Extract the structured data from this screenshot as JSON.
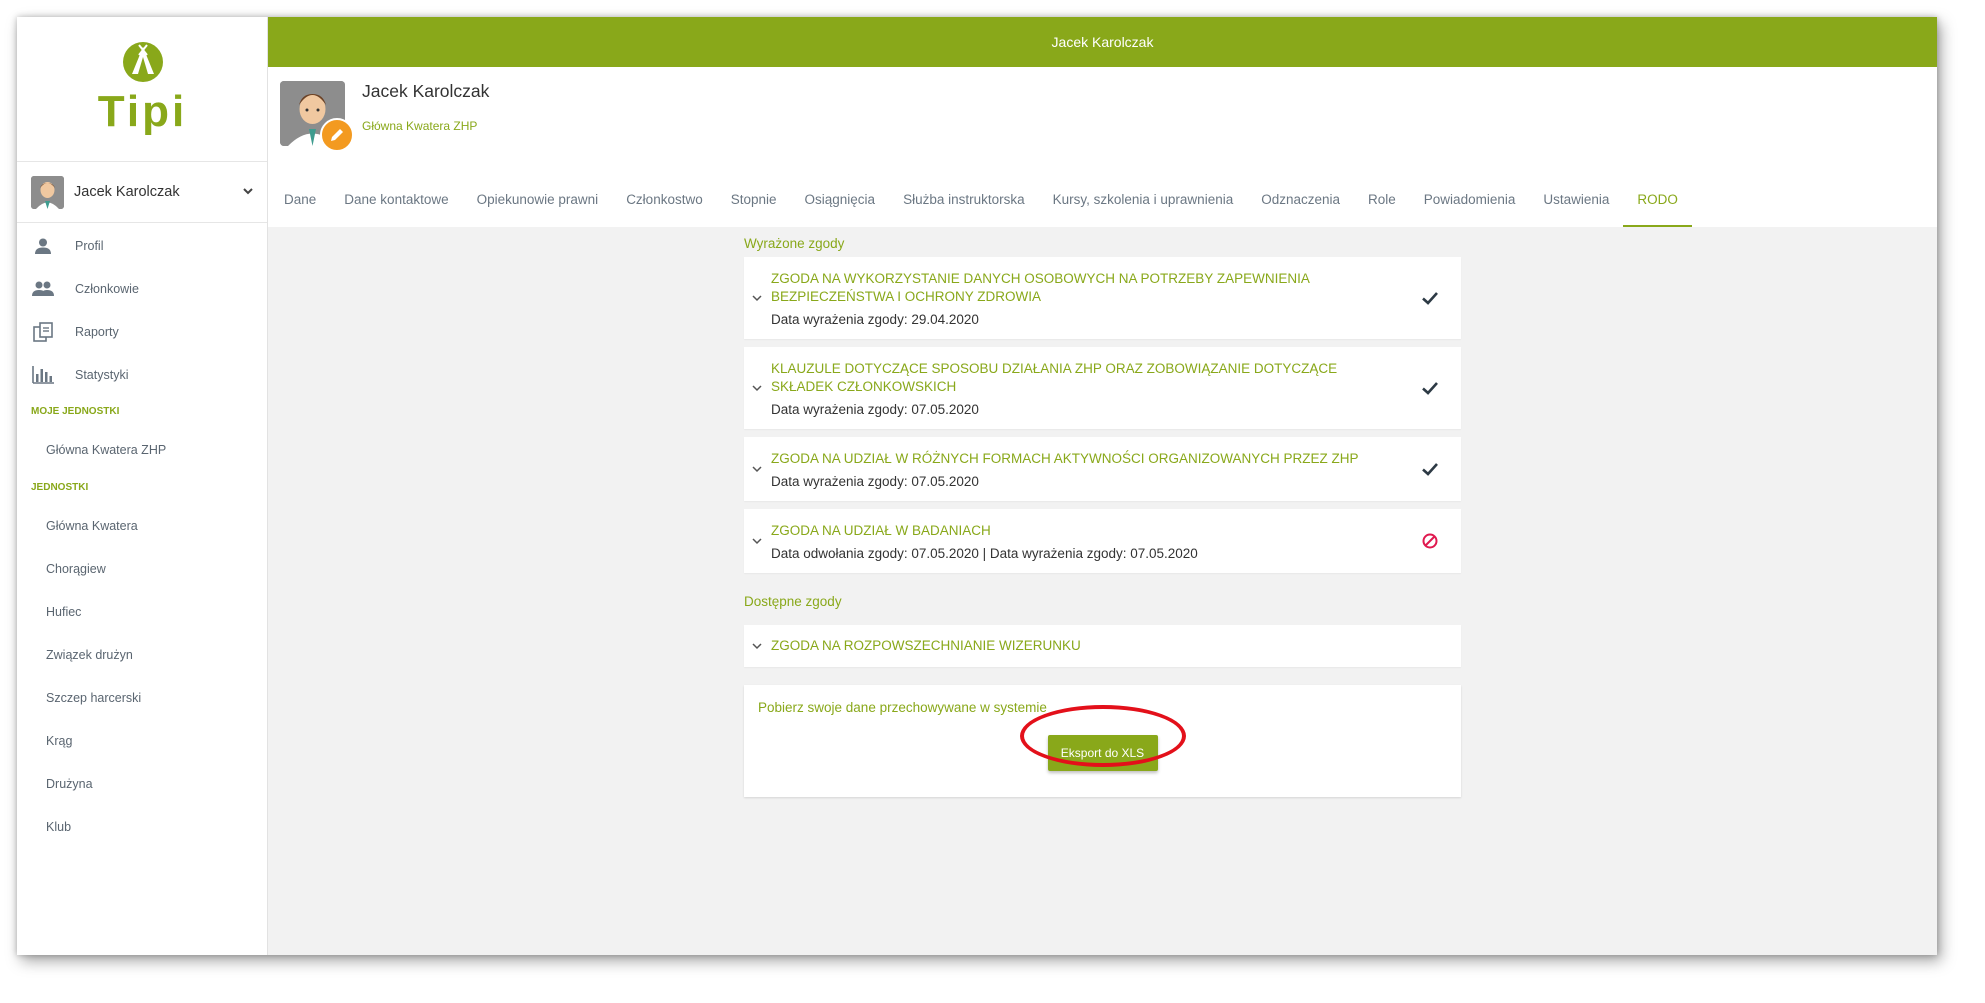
{
  "app": {
    "logo_text": "Tipi"
  },
  "topbar": {
    "title": "Jacek Karolczak"
  },
  "user_menu": {
    "name": "Jacek Karolczak"
  },
  "nav": {
    "items": [
      {
        "label": "Profil",
        "icon": "person-icon"
      },
      {
        "label": "Członkowie",
        "icon": "group-icon"
      },
      {
        "label": "Raporty",
        "icon": "reports-icon"
      },
      {
        "label": "Statystyki",
        "icon": "bar-chart-icon"
      }
    ],
    "my_units_header": "MOJE JEDNOSTKI",
    "my_units": [
      "Główna Kwatera ZHP"
    ],
    "units_header": "JEDNOSTKI",
    "units": [
      "Główna Kwatera",
      "Chorągiew",
      "Hufiec",
      "Związek drużyn",
      "Szczep harcerski",
      "Krąg",
      "Drużyna",
      "Klub"
    ]
  },
  "profile": {
    "name": "Jacek Karolczak",
    "unit": "Główna Kwatera ZHP"
  },
  "tabs": [
    {
      "label": "Dane"
    },
    {
      "label": "Dane kontaktowe"
    },
    {
      "label": "Opiekunowie prawni"
    },
    {
      "label": "Członkostwo"
    },
    {
      "label": "Stopnie"
    },
    {
      "label": "Osiągnięcia"
    },
    {
      "label": "Służba instruktorska"
    },
    {
      "label": "Kursy, szkolenia i uprawnienia"
    },
    {
      "label": "Odznaczenia"
    },
    {
      "label": "Role"
    },
    {
      "label": "Powiadomienia"
    },
    {
      "label": "Ustawienia"
    },
    {
      "label": "RODO"
    }
  ],
  "active_tab": "RODO",
  "given_consents": {
    "title": "Wyrażone zgody",
    "items": [
      {
        "title": "ZGODA NA WYKORZYSTANIE DANYCH OSOBOWYCH NA POTRZEBY ZAPEWNIENIA BEZPIECZEŃSTWA I OCHRONY ZDROWIA",
        "date": "Data wyrażenia zgody: 29.04.2020",
        "status": "granted"
      },
      {
        "title": "KLAUZULE DOTYCZĄCE SPOSOBU DZIAŁANIA ZHP ORAZ ZOBOWIĄZANIE DOTYCZĄCE SKŁADEK CZŁONKOWSKICH",
        "date": "Data wyrażenia zgody: 07.05.2020",
        "status": "granted"
      },
      {
        "title": "ZGODA NA UDZIAŁ W RÓŻNYCH FORMACH AKTYWNOŚCI ORGANIZOWANYCH PRZEZ ZHP",
        "date": "Data wyrażenia zgody: 07.05.2020",
        "status": "granted"
      },
      {
        "title": "ZGODA NA UDZIAŁ W BADANIACH",
        "date": "Data odwołania zgody: 07.05.2020 | Data wyrażenia zgody: 07.05.2020",
        "status": "revoked"
      }
    ]
  },
  "available_consents": {
    "title": "Dostępne zgody",
    "items": [
      {
        "title": "ZGODA NA ROZPOWSZECHNIANIE WIZERUNKU"
      }
    ]
  },
  "export": {
    "text": "Pobierz swoje dane przechowywane w systemie",
    "button_label": "Eksport do XLS"
  },
  "colors": {
    "brand_green": "#89a81a",
    "badge_orange": "#f39a20",
    "revoked_red": "#e0194f",
    "highlight_red": "#e3101a"
  }
}
